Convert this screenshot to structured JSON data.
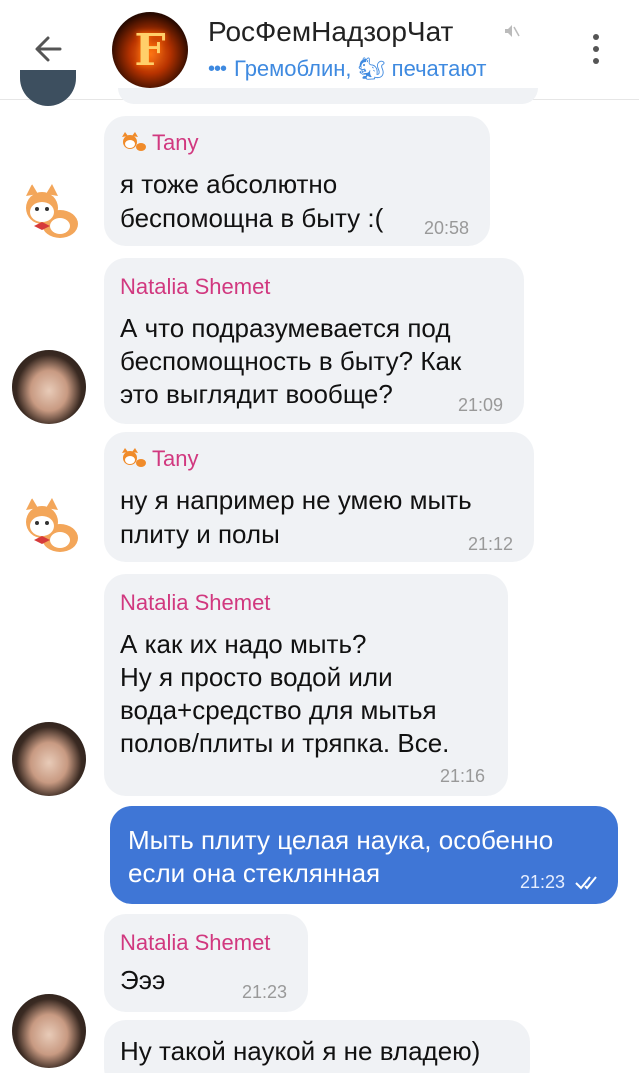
{
  "header": {
    "chat_title": "РосФемНадзорЧат",
    "typing_text": "Гремоблин, 🐿 печатают",
    "dots": "•••"
  },
  "messages": [
    {
      "sender": "Tany",
      "lines": [
        "я тоже абсолютно",
        "беспомощна в быту :("
      ],
      "time": "20:58"
    },
    {
      "sender": "Natalia Shemet",
      "lines": [
        "А что подразумевается под",
        "беспомощность в быту? Как",
        "это выглядит вообще?"
      ],
      "time": "21:09"
    },
    {
      "sender": "Tany",
      "lines": [
        "ну я например не умею мыть",
        "плиту и полы"
      ],
      "time": "21:12"
    },
    {
      "sender": "Natalia Shemet",
      "lines": [
        "А как их надо мыть?",
        "Ну я просто водой или",
        "вода+средство для мытья",
        "полов/плиты и тряпка. Все."
      ],
      "time": "21:16"
    },
    {
      "sender": "",
      "lines": [
        "Мыть плиту целая наука, особенно",
        "если она стеклянная"
      ],
      "time": "21:23"
    },
    {
      "sender": "Natalia Shemet",
      "lines": [
        "Эээ"
      ],
      "time": "21:23"
    },
    {
      "sender": "",
      "lines": [
        "Ну такой наукой я не владею)"
      ],
      "time": ""
    }
  ],
  "colors": {
    "accent": "#3f8ae0",
    "outgoing": "#3f76d6",
    "sender": "#d1387f",
    "incoming": "#f0f2f5"
  }
}
